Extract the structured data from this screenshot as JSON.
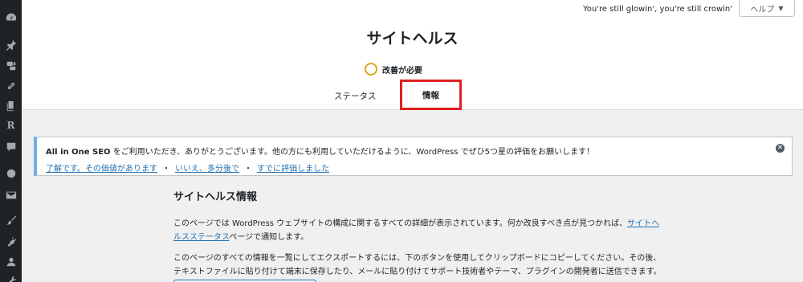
{
  "header": {
    "tagline": "You're still glowin', you're still crowin'",
    "help_label": "ヘルプ",
    "page_title": "サイトヘルス",
    "status_label": "改善が必要",
    "tabs": [
      {
        "label": "ステータス"
      },
      {
        "label": "情報"
      }
    ]
  },
  "sidebar": {
    "icons": [
      "dashboard-icon",
      "pin-icon",
      "media-icon",
      "link-icon",
      "pages-icon",
      "rankmath-icon",
      "comments-icon",
      "circle-icon",
      "mail-icon",
      "appearance-icon",
      "plugins-icon",
      "users-icon",
      "tools-icon"
    ],
    "r_label": "R"
  },
  "notice": {
    "brand": "All in One SEO",
    "message": "をご利用いただき、ありがとうございます。他の方にも利用していただけるように、WordPress でぜひ5つ星の評価をお願いします！",
    "links": [
      "了解です。その価値があります",
      "いいえ、多分後で",
      "すでに評価しました"
    ],
    "separator": "・",
    "dismiss": "✕"
  },
  "main": {
    "title": "サイトヘルス情報",
    "para1_prefix": "このページでは WordPress ウェブサイトの構成に関するすべての詳細が表示されています。何か改良すべき点が見つかれば、",
    "para1_link": "サイトヘルスステータス",
    "para1_suffix": "ページで通知します。",
    "para2": "このページのすべての情報を一覧にしてエクスポートするには、下のボタンを使用してクリップボードにコピーしてください。その後、テキストファイルに貼り付けて端末に保存したり、メールに貼り付けてサポート技術者やテーマ、プラグインの開発者に送信できます。"
  },
  "colors": {
    "sidebar": "#1d2327",
    "accent": "#2271b1",
    "status_ring": "#dba617",
    "highlight_box": "#e02020",
    "notice_border": "#72aee6"
  }
}
